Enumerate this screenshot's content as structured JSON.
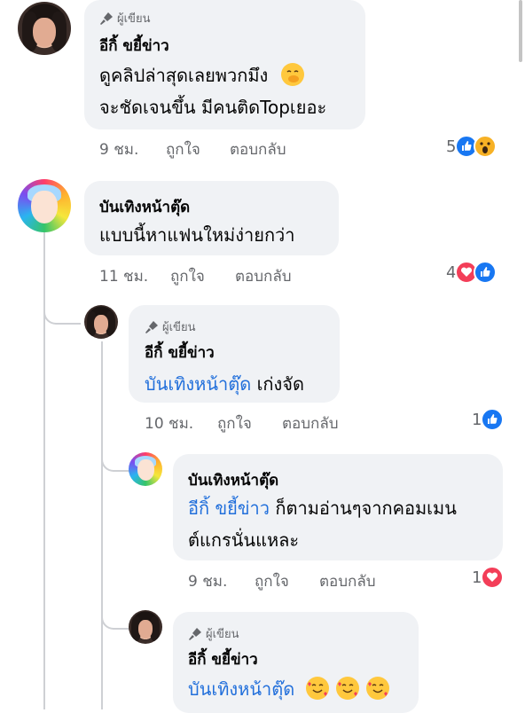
{
  "comments": [
    {
      "badge": "ผู้เขียน",
      "author": "อีกิ้ ขยี้ข่าว",
      "lines": [
        "ดูคลิปล่าสุดเลยพวกมึง",
        "จะชัดเจนขึ้น มีคนติดTopเยอะ"
      ],
      "time": "9 ชม.",
      "like": "ถูกใจ",
      "reply": "ตอบกลับ",
      "reaction_count": "5",
      "reactions": [
        "like",
        "wow"
      ],
      "emoji": "hand-over-mouth-emoji"
    },
    {
      "author": "บันเทิงหน้าตุ๊ด",
      "lines": [
        "แบบนี้หาแฟนใหม่ง่ายกว่า"
      ],
      "time": "11 ชม.",
      "like": "ถูกใจ",
      "reply": "ตอบกลับ",
      "reaction_count": "4",
      "reactions": [
        "love",
        "like"
      ]
    },
    {
      "badge": "ผู้เขียน",
      "author": "อีกิ้ ขยี้ข่าว",
      "mention": "บันเทิงหน้าตุ๊ด",
      "text": "เก่งจัด",
      "time": "10 ชม.",
      "like": "ถูกใจ",
      "reply": "ตอบกลับ",
      "reaction_count": "1",
      "reactions": [
        "like"
      ]
    },
    {
      "author": "บันเทิงหน้าตุ๊ด",
      "mention": "อีกิ้ ขยี้ข่าว",
      "text": "ก็ตามอ่านๆจากคอมเมน",
      "line2": "ต์แกรนั่นแหละ",
      "time": "9 ชม.",
      "like": "ถูกใจ",
      "reply": "ตอบกลับ",
      "reaction_count": "1",
      "reactions": [
        "love"
      ]
    },
    {
      "badge": "ผู้เขียน",
      "author": "อีกิ้ ขยี้ข่าว",
      "mention": "บันเทิงหน้าตุ๊ด",
      "emoji": [
        "smiling-face-with-hearts-emoji",
        "smiling-face-with-hearts-emoji",
        "smiling-face-with-hearts-emoji"
      ]
    }
  ],
  "colors": {
    "bubble": "#f0f2f5",
    "mention": "#216fdb",
    "meta": "#65676b",
    "like_blue": "#1877f2",
    "love_red": "#f33e58",
    "wow_yellow": "#f7b125"
  }
}
